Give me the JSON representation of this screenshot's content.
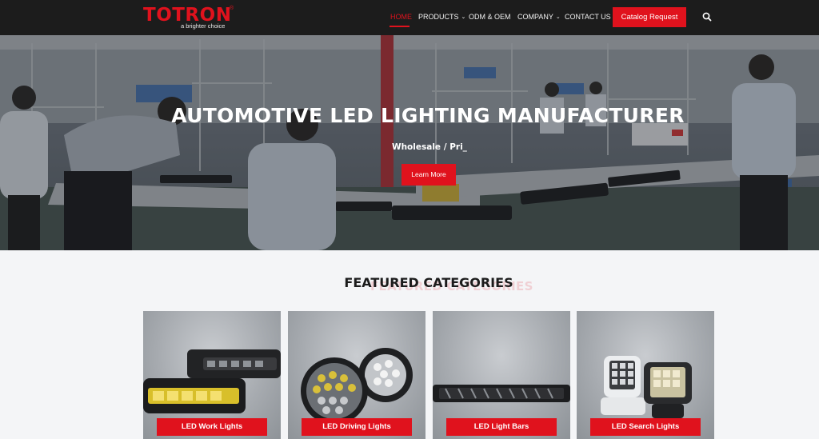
{
  "brand": {
    "name": "TOTRON",
    "tagline": "a brighter choice",
    "registered": "®"
  },
  "nav": {
    "home": "HOME",
    "products": "PRODUCTS",
    "odm": "ODM & OEM",
    "company": "COMPANY",
    "contact": "CONTACT US",
    "catalog": "Catalog Request"
  },
  "hero": {
    "title": "AUTOMOTIVE LED LIGHTING MANUFACTURER",
    "subtitle": "Wholesale / Pri_",
    "button": "Learn More"
  },
  "featured": {
    "title": "FEATURED CATEGORIES",
    "ghost": "FEATURED CATEGORIES",
    "cards": [
      {
        "label": "LED Work Lights"
      },
      {
        "label": "LED Driving Lights"
      },
      {
        "label": "LED Light Bars"
      },
      {
        "label": "LED Search Lights"
      }
    ]
  },
  "colors": {
    "accent": "#e0121d",
    "nav_bg": "#1c1c1c",
    "page_bg": "#f4f5f7"
  }
}
